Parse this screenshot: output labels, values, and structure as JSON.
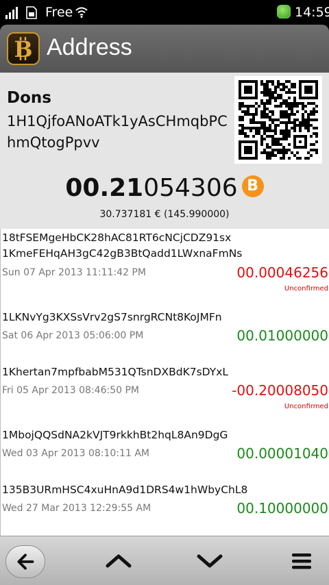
{
  "status_bar": {
    "carrier": "Free",
    "time": "14:59"
  },
  "header": {
    "title": "Address",
    "logo_icon": "bitcoin-logo-icon"
  },
  "address": {
    "label": "Dons",
    "address": "1H1QjfoANoATk1yAsCHmqbPChmQtogPpvv",
    "balance_bold": "00.21",
    "balance_rest": "054306",
    "currency_icon": "B",
    "fiat": "30.737181 € (145.990000)"
  },
  "transactions": [
    {
      "addresses": [
        "18tFSEMgeHbCK28hAC81RT6cNCjCDZ91sx",
        "1KmeFEHqAH3gC42gB3BtQadd1LWxnaFmNs"
      ],
      "date": "Sun 07 Apr 2013 11:11:42 PM",
      "amount": "00.00046256",
      "amount_color": "#e01010",
      "status": "Unconfirmed"
    },
    {
      "addresses": [
        "1LKNvYg3KXSsVrv2gS7snrgRCNt8KoJMFn"
      ],
      "date": "Sat 06 Apr 2013 05:06:00 PM",
      "amount": "00.01000000",
      "amount_color": "#1a8a1a",
      "status": ""
    },
    {
      "addresses": [
        "1Khertan7mpfbabM531QTsnDXBdK7sDYxL"
      ],
      "date": "Fri 05 Apr 2013 08:46:50 PM",
      "amount": "-00.20008050",
      "amount_color": "#e01010",
      "status": "Unconfirmed"
    },
    {
      "addresses": [
        "1MbojQQSdNA2kVJT9rkkhBt2hqL8An9DgG"
      ],
      "date": "Wed 03 Apr 2013 08:10:11 AM",
      "amount": "00.00001040",
      "amount_color": "#1a8a1a",
      "status": ""
    },
    {
      "addresses": [
        "135B3URmHSC4xuHnA9d1DRS4w1hWbyChL8"
      ],
      "date": "Wed 27 Mar 2013 12:29:55 AM",
      "amount": "00.10000000",
      "amount_color": "#1a8a1a",
      "status": ""
    }
  ],
  "toolbar": {
    "back_icon": "back-arrow-icon",
    "up_icon": "chevron-up-icon",
    "down_icon": "chevron-down-icon",
    "menu_icon": "menu-icon"
  }
}
